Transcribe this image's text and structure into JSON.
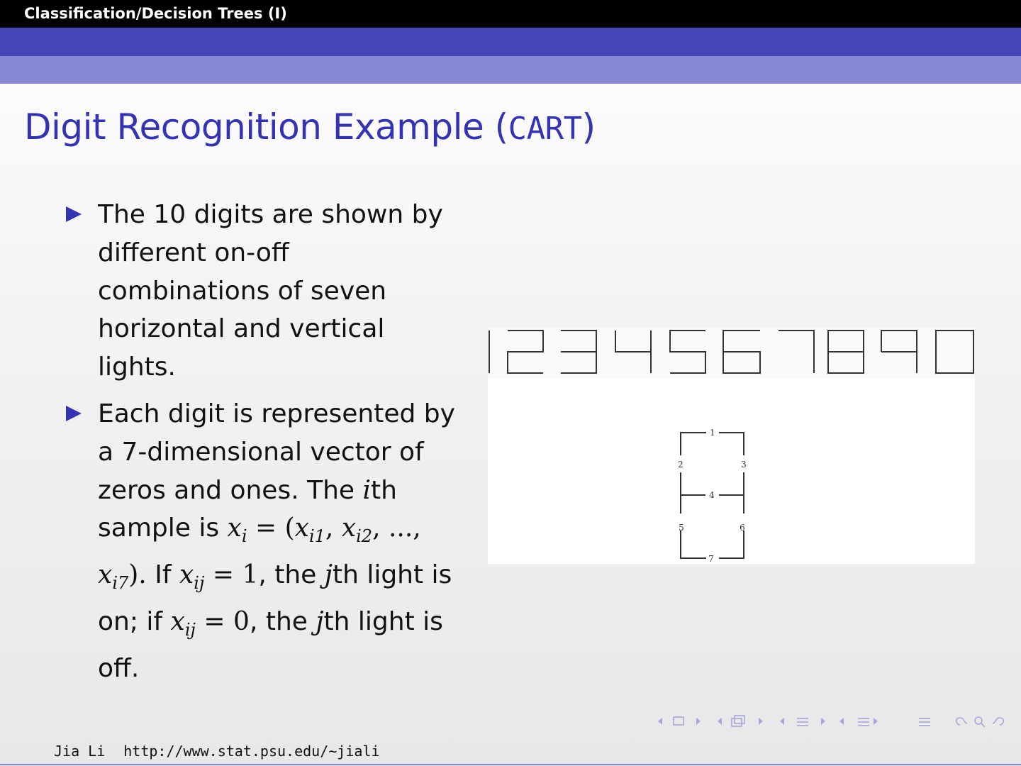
{
  "header": {
    "section_title": "Classification/Decision Trees (I)"
  },
  "frame": {
    "title_prefix": "Digit Recognition Example (",
    "title_mono": "CART",
    "title_suffix": ")"
  },
  "bullets": {
    "b1": "The 10 digits are shown by different on-off combinations of seven horizontal and vertical lights.",
    "b2_line1": "Each digit is represented by a 7-dimensional vector of zeros and ones. The ",
    "b2_i": "i",
    "b2_line2": "th sample is",
    "b2_x": "x",
    "b2_sub_i": "i",
    "b2_eq": " = (",
    "b2_xi1": "x",
    "b2_sub_i1": "i1",
    "b2_comma1": ", ",
    "b2_xi2": "x",
    "b2_sub_i2": "i2",
    "b2_dots": ", ..., ",
    "b2_xi7": "x",
    "b2_sub_i7": "i7",
    "b2_close": ").",
    "b2_if": " If",
    "b2_xij": "x",
    "b2_sub_ij": "ij",
    "b2_eq1": " = 1",
    "b2_on": ", the ",
    "b2_j1": "j",
    "b2_on2": "th light is on; if ",
    "b2_xij2": "x",
    "b2_sub_ij2": "ij",
    "b2_eq0": " = 0",
    "b2_off": ", the ",
    "b2_j2": "j",
    "b2_off2": "th light is off."
  },
  "figure": {
    "segment_labels": [
      "1",
      "2",
      "3",
      "4",
      "5",
      "6",
      "7"
    ]
  },
  "footer": {
    "author": "Jia Li",
    "url": "http://www.stat.psu.edu/∼jiali"
  }
}
